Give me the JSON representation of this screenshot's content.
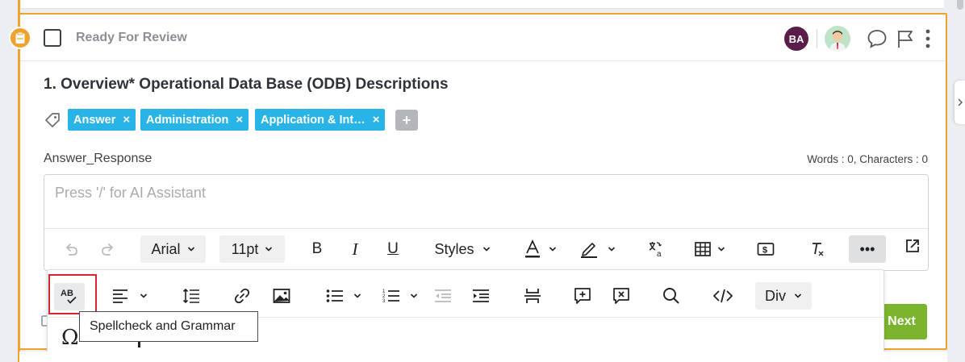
{
  "card": {
    "status": "Ready For Review",
    "title": "1. Overview* Operational Data Base (ODB) Descriptions",
    "assignee_initials": "BA",
    "tags": [
      {
        "label": "Answer"
      },
      {
        "label": "Administration"
      },
      {
        "label": "Application & Int…"
      }
    ],
    "tag_remove_symbol": "×",
    "tag_add_symbol": "+",
    "field_label": "Answer_Response",
    "word_count": "Words : 0, Characters : 0"
  },
  "editor": {
    "placeholder": "Press '/' for AI Assistant",
    "font_family": "Arial",
    "font_size": "11pt",
    "styles_label": "Styles",
    "bold": "B",
    "italic": "I",
    "underline": "U",
    "more": "•••",
    "block_format": "Div"
  },
  "tooltip": "Spellcheck and Grammar",
  "omega_symbol": "Ω",
  "next_label": "Next",
  "colors": {
    "card_border": "#f0a22e",
    "tag_bg": "#28b4e6",
    "next_bg": "#7bb52e",
    "highlight": "#d9232e",
    "avatar_bg": "#5a1d4a"
  }
}
